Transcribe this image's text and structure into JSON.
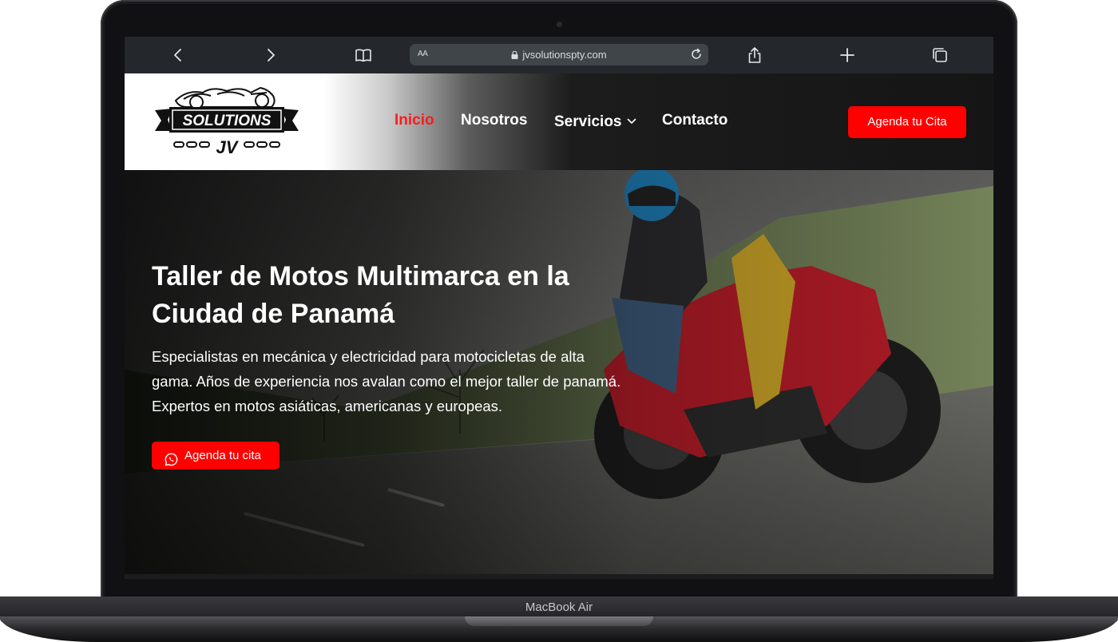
{
  "device": {
    "label": "MacBook Air"
  },
  "browser": {
    "address_aa": "AA",
    "url": "jvsolutionspty.com",
    "icons": [
      "chevron-left-icon",
      "chevron-right-icon",
      "book-icon",
      "share-icon",
      "plus-icon",
      "tabs-icon",
      "reload-icon",
      "lock-icon"
    ]
  },
  "header": {
    "logo_top": "SOLUTIONS",
    "logo_bottom": "JV",
    "nav": [
      {
        "label": "Inicio",
        "active": true
      },
      {
        "label": "Nosotros",
        "active": false
      },
      {
        "label": "Servicios",
        "active": false,
        "has_dropdown": true
      },
      {
        "label": "Contacto",
        "active": false
      }
    ],
    "cta_label": "Agenda tu Cita"
  },
  "hero": {
    "title": "Taller de Motos Multimarca en la Ciudad de Panamá",
    "description": "Especialistas en mecánica y electricidad para motocicletas de alta gama. Años de experiencia nos avalan como el mejor taller de panamá. Expertos en motos asiáticas, americanas y europeas.",
    "button_label": "Agenda tu cita",
    "button_icon": "whatsapp-icon"
  },
  "colors": {
    "accent": "#ff0000",
    "active_nav": "#ff1a1a",
    "browser_bar": "#24282c",
    "header_dark": "#151515"
  }
}
